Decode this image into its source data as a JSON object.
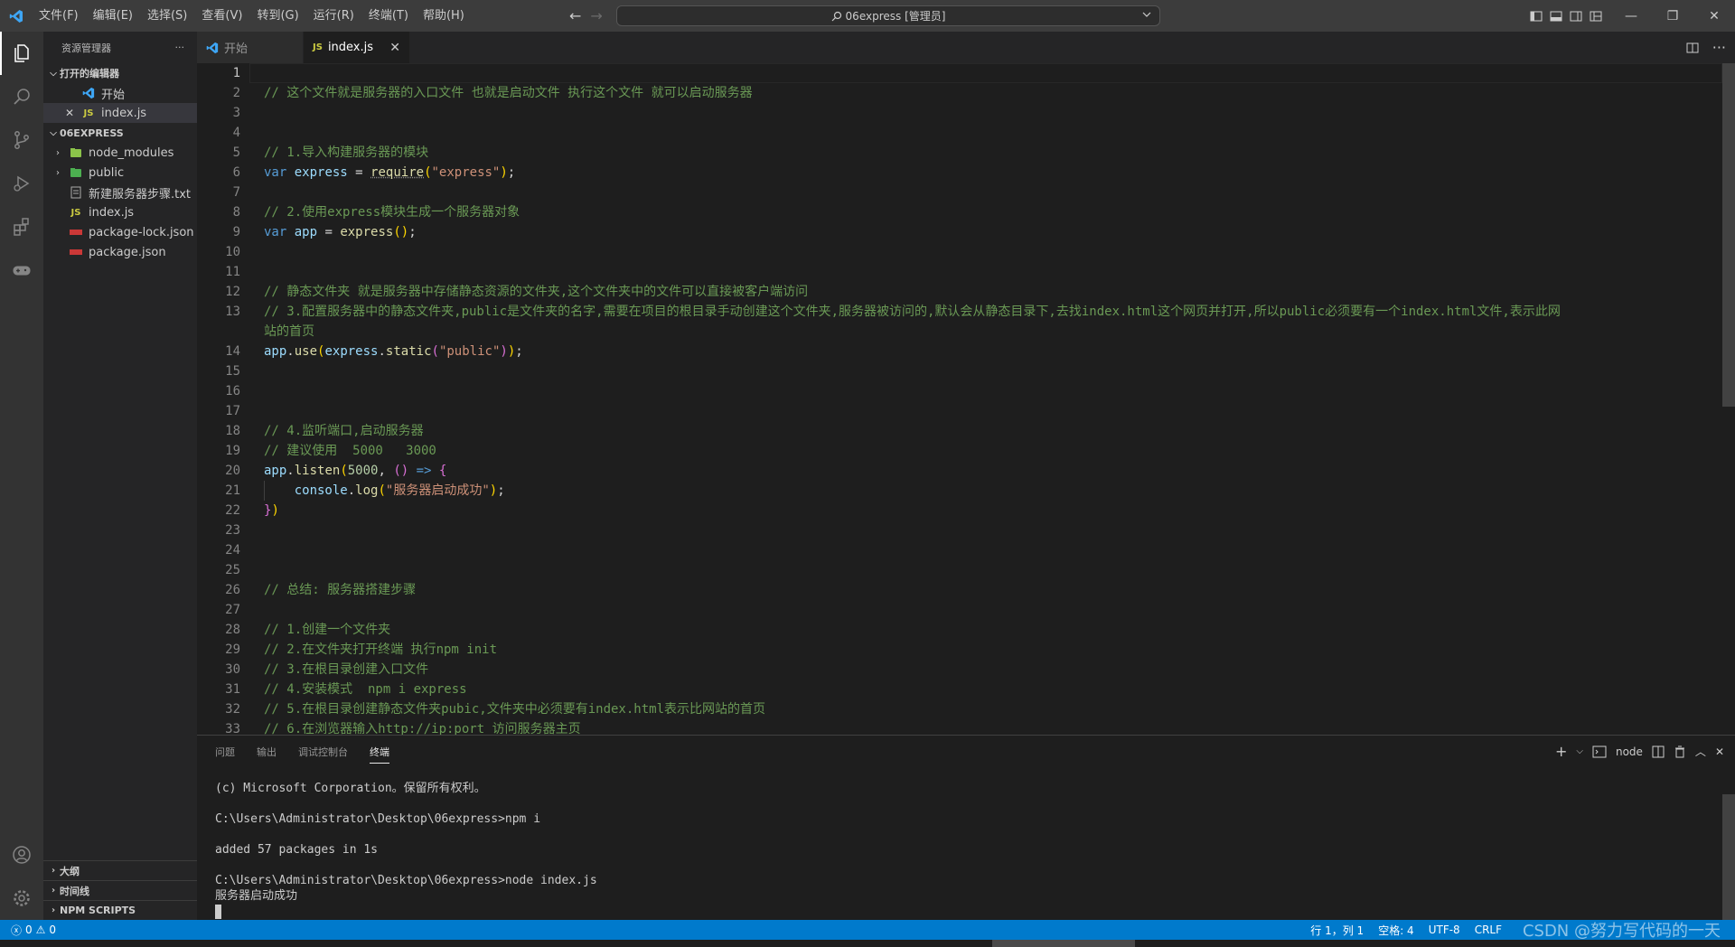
{
  "titlebar": {
    "menu": [
      "文件(F)",
      "编辑(E)",
      "选择(S)",
      "查看(V)",
      "转到(G)",
      "运行(R)",
      "终端(T)",
      "帮助(H)"
    ],
    "command_center": "06express [管理员]"
  },
  "sidebar": {
    "title": "资源管理器",
    "open_editors_label": "打开的编辑器",
    "open_editors": [
      {
        "label": "开始"
      },
      {
        "label": "index.js"
      }
    ],
    "folder_label": "06EXPRESS",
    "files": [
      {
        "label": "node_modules"
      },
      {
        "label": "public"
      },
      {
        "label": "新建服务器步骤.txt"
      },
      {
        "label": "index.js"
      },
      {
        "label": "package-lock.json"
      },
      {
        "label": "package.json"
      }
    ],
    "outline_label": "大纲",
    "timeline_label": "时间线",
    "npm_label": "NPM SCRIPTS"
  },
  "tabs": [
    {
      "label": "开始"
    },
    {
      "label": "index.js"
    }
  ],
  "editor": {
    "line_numbers": [
      "1",
      "2",
      "3",
      "4",
      "5",
      "6",
      "7",
      "8",
      "9",
      "10",
      "11",
      "12",
      "13",
      "",
      "14",
      "15",
      "16",
      "17",
      "18",
      "19",
      "20",
      "21",
      "22",
      "23",
      "24",
      "25",
      "26",
      "27",
      "28",
      "29",
      "30",
      "31",
      "32",
      "33"
    ],
    "comments": {
      "l2": "// 这个文件就是服务器的入口文件 也就是启动文件 执行这个文件 就可以启动服务器",
      "l5": "// 1.导入构建服务器的模块",
      "l8": "// 2.使用express模块生成一个服务器对象",
      "l12": "// 静态文件夹 就是服务器中存储静态资源的文件夹,这个文件夹中的文件可以直接被客户端访问",
      "l13a": "// 3.配置服务器中的静态文件夹,public是文件夹的名字,需要在项目的根目录手动创建这个文件夹,服务器被访问的,默认会从静态目录下,去找index.html这个网页并打开,所以public必须要有一个index.html文件,表示此网",
      "l13b": "站的首页",
      "l18": "// 4.监听端口,启动服务器",
      "l19": "// 建议使用  5000   3000",
      "l26": "// 总结: 服务器搭建步骤",
      "l28": "// 1.创建一个文件夹",
      "l29": "// 2.在文件夹打开终端 执行npm init",
      "l30": "// 3.在根目录创建入口文件",
      "l31": "// 4.安装模式  npm i express",
      "l32": "// 5.在根目录创建静态文件夹pubic,文件夹中必须要有index.html表示比网站的首页",
      "l33": "// 6.在浏览器输入http://ip:port 访问服务器主页"
    },
    "tokens": {
      "var": "var",
      "express": "express",
      "require": "require",
      "express_str": "\"express\"",
      "app": "app",
      "use": "use",
      "static": "static",
      "public_str": "\"public\"",
      "listen": "listen",
      "port": "5000",
      "console": "console",
      "log": "log",
      "msg_str": "\"服务器启动成功\""
    }
  },
  "panel": {
    "tabs": [
      "问题",
      "输出",
      "调试控制台",
      "终端"
    ],
    "active_tab": "终端",
    "shell_label": "node",
    "terminal_lines": [
      "(c) Microsoft Corporation。保留所有权利。",
      "C:\\Users\\Administrator\\Desktop\\06express>npm i",
      "added 57 packages in 1s",
      "C:\\Users\\Administrator\\Desktop\\06express>node index.js",
      "服务器启动成功"
    ]
  },
  "statusbar": {
    "errors": "0",
    "warnings": "0",
    "position": "行 1，列 1",
    "spaces": "空格: 4",
    "encoding": "UTF-8",
    "eol": "CRLF"
  },
  "watermark": "CSDN @努力写代码的一天"
}
